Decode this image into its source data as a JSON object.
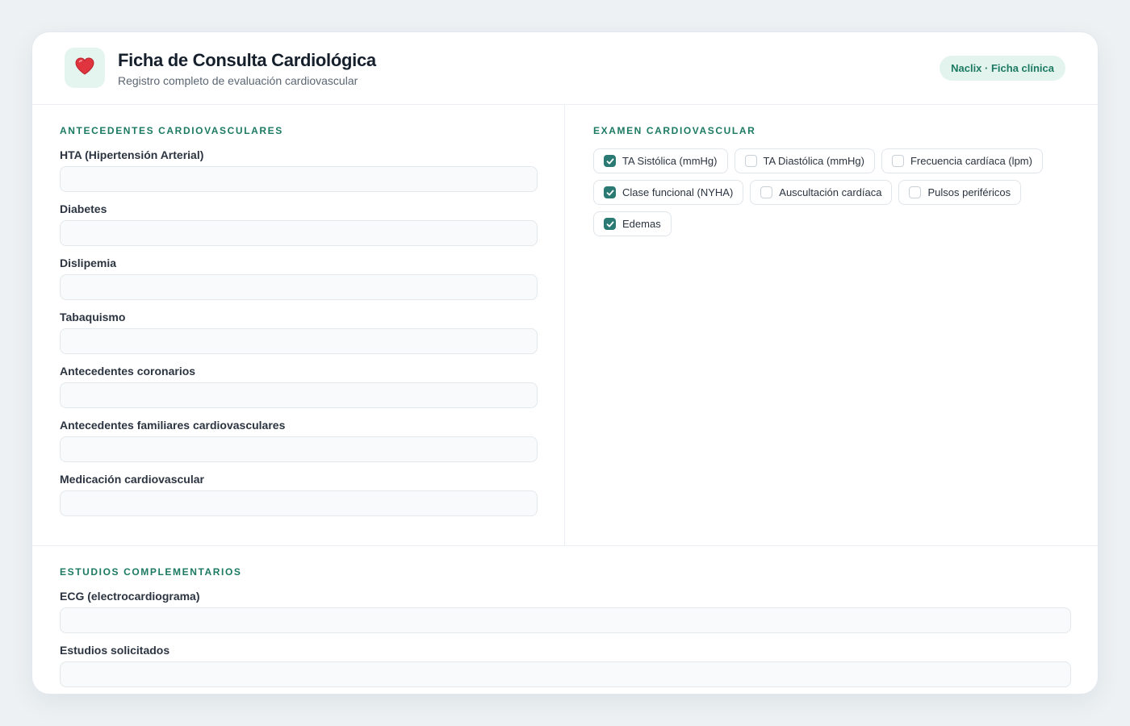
{
  "header": {
    "title": "Ficha de Consulta Cardiológica",
    "subtitle": "Registro completo de evaluación cardiovascular",
    "badge": "Naclix · Ficha clínica",
    "icon": "heart-icon"
  },
  "antecedentes": {
    "title": "Antecedentes Cardiovasculares",
    "fields": [
      {
        "label": "HTA (Hipertensión Arterial)",
        "value": ""
      },
      {
        "label": "Diabetes",
        "value": ""
      },
      {
        "label": "Dislipemia",
        "value": ""
      },
      {
        "label": "Tabaquismo",
        "value": ""
      },
      {
        "label": "Antecedentes coronarios",
        "value": ""
      },
      {
        "label": "Antecedentes familiares cardiovasculares",
        "value": ""
      },
      {
        "label": "Medicación cardiovascular",
        "value": ""
      }
    ]
  },
  "examen": {
    "title": "Examen Cardiovascular",
    "options": [
      {
        "label": "TA Sistólica (mmHg)",
        "checked": true
      },
      {
        "label": "TA Diastólica (mmHg)",
        "checked": false
      },
      {
        "label": "Frecuencia cardíaca (lpm)",
        "checked": false
      },
      {
        "label": "Clase funcional (NYHA)",
        "checked": true
      },
      {
        "label": "Auscultación cardíaca",
        "checked": false
      },
      {
        "label": "Pulsos periféricos",
        "checked": false
      },
      {
        "label": "Edemas",
        "checked": true
      }
    ]
  },
  "estudios": {
    "title": "Estudios Complementarios",
    "fields": [
      {
        "label": "ECG (electrocardiograma)",
        "value": ""
      },
      {
        "label": "Estudios solicitados",
        "value": ""
      }
    ]
  },
  "colors": {
    "accent": "#1c7a62",
    "checkbox": "#2a7a73",
    "heart": "#e0343f"
  }
}
